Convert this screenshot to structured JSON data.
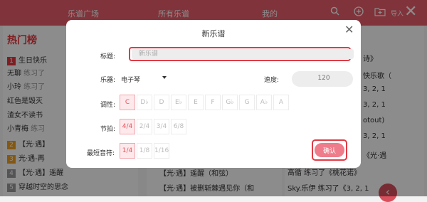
{
  "topbar": {
    "nav": [
      "乐谱广场",
      "所有乐谱",
      "我的"
    ],
    "export_label": "导入"
  },
  "hot": {
    "title": "热门榜",
    "rows": [
      {
        "rank": "1",
        "text": "生日快乐",
        "sub": "",
        "rank_color": "#e8383f"
      },
      {
        "rank": "",
        "text": "无聊",
        "sub": " 练习了",
        "rank_color": ""
      },
      {
        "rank": "",
        "text": "小玲",
        "sub": " 练习了",
        "rank_color": ""
      },
      {
        "rank": "",
        "text": "红色是毁灭",
        "sub": "",
        "rank_color": ""
      },
      {
        "rank": "",
        "text": "渣女不读书",
        "sub": "",
        "rank_color": ""
      },
      {
        "rank": "",
        "text": "小青梅",
        "sub": " 练习",
        "rank_color": ""
      },
      {
        "rank": "2",
        "text": "【光·遇】",
        "sub": "",
        "rank_color": "#f0a020"
      },
      {
        "rank": "3",
        "text": "光·遇-再",
        "sub": "",
        "rank_color": "#f0a020"
      },
      {
        "rank": "4",
        "text": "【光·遇】遥醒（和弦）",
        "sub": "",
        "rank_color": "#9a9a9a"
      },
      {
        "rank": "5",
        "text": "穿越时空的思念",
        "sub": "",
        "rank_color": "#9a9a9a"
      }
    ]
  },
  "middle": {
    "rows": [
      "【光·遇】遥醒（和弦）",
      "【光·遇】被删斩棘遇见你（和"
    ]
  },
  "right": {
    "rows": [
      "诗》",
      "快乐歌（",
      "3, 2, 1",
      "3, 2, 1",
      "otout)",
      "3, 2, 1",
      "《光·遇",
      "高循 练习了《桃花诺》",
      "Sky.乐伊 练习了《3, 2, 1"
    ]
  },
  "modal": {
    "title": "新乐谱",
    "title_label": "标题:",
    "title_placeholder": "新乐谱",
    "instrument_label": "乐器:",
    "instrument_value": "电子琴",
    "tempo_label": "速度:",
    "tempo_placeholder": "120",
    "key_label": "调性:",
    "keys": [
      "C",
      "D♭",
      "D",
      "E♭",
      "E",
      "F",
      "G♭",
      "G",
      "A♭",
      "A"
    ],
    "selected_key": "C",
    "beat_label": "节拍:",
    "beats": [
      "4/4",
      "2/4",
      "3/4",
      "6/8"
    ],
    "selected_beat": "4/4",
    "note_label": "最短音符:",
    "notes": [
      "1/4",
      "1/8",
      "1/16"
    ],
    "selected_note": "1/4",
    "confirm_label": "确认"
  },
  "colors": {
    "accent": "#e95d6a",
    "highlight_border": "#e23b45",
    "confirm_button": "#ee7c8a"
  }
}
